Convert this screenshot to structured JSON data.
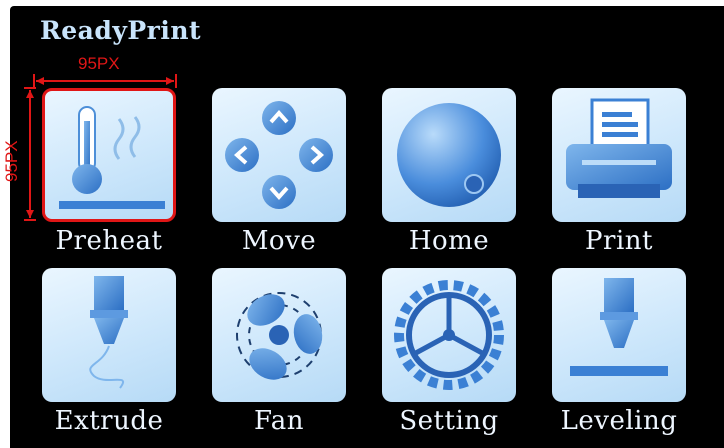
{
  "screen": {
    "title": "ReadyPrint",
    "accent": "#c9e4fb",
    "selection_color": "#e01616"
  },
  "annotation": {
    "width_label": "95PX",
    "height_label": "95PX"
  },
  "tiles": [
    {
      "label": "Preheat",
      "icon": "thermometer-icon",
      "selected": true
    },
    {
      "label": "Move",
      "icon": "move-arrows-icon",
      "selected": false
    },
    {
      "label": "Home",
      "icon": "home-sphere-icon",
      "selected": false
    },
    {
      "label": "Print",
      "icon": "printer-icon",
      "selected": false
    },
    {
      "label": "Extrude",
      "icon": "nozzle-extrude-icon",
      "selected": false
    },
    {
      "label": "Fan",
      "icon": "fan-icon",
      "selected": false
    },
    {
      "label": "Setting",
      "icon": "gear-icon",
      "selected": false
    },
    {
      "label": "Leveling",
      "icon": "leveling-nozzle-icon",
      "selected": false
    }
  ]
}
